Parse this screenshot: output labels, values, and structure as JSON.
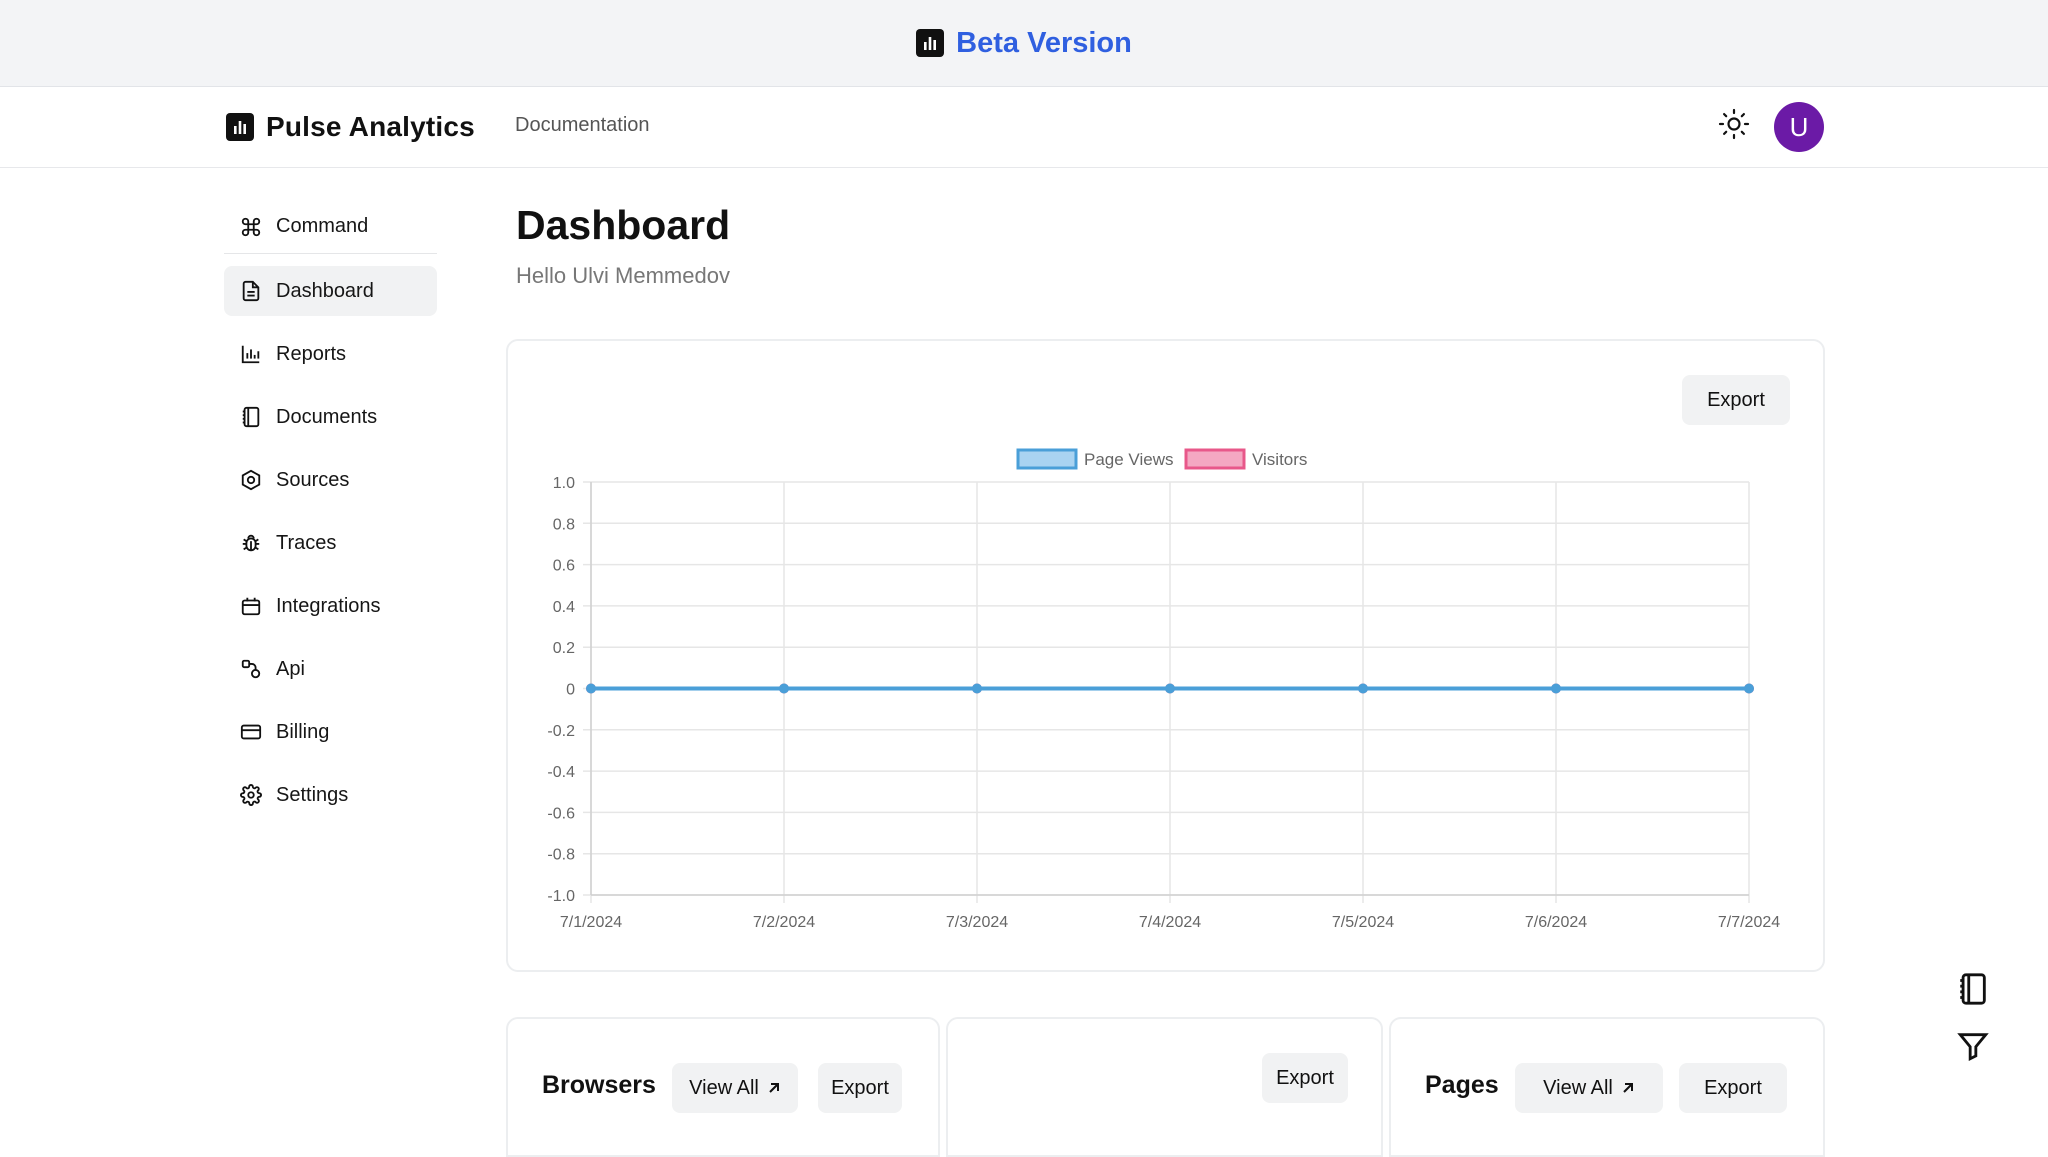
{
  "banner": {
    "text": "Beta Version",
    "icon": "bar-chart-icon"
  },
  "header": {
    "brand": "Pulse Analytics",
    "nav_link": "Documentation",
    "theme_icon": "sun-icon",
    "avatar_initial": "U",
    "avatar_color": "#6b1aa6"
  },
  "sidebar": {
    "items": [
      {
        "label": "Command",
        "icon": "command-icon"
      },
      {
        "label": "Dashboard",
        "icon": "file-text-icon"
      },
      {
        "label": "Reports",
        "icon": "bar-chart-icon"
      },
      {
        "label": "Documents",
        "icon": "notebook-icon"
      },
      {
        "label": "Sources",
        "icon": "hexagon-icon"
      },
      {
        "label": "Traces",
        "icon": "bug-icon"
      },
      {
        "label": "Integrations",
        "icon": "calendar-icon"
      },
      {
        "label": "Api",
        "icon": "api-icon"
      },
      {
        "label": "Billing",
        "icon": "credit-card-icon"
      },
      {
        "label": "Settings",
        "icon": "gear-icon"
      }
    ]
  },
  "main": {
    "title": "Dashboard",
    "greeting": "Hello Ulvi Memmedov",
    "chart_card": {
      "export_label": "Export"
    },
    "browsers_card": {
      "title": "Browsers",
      "view_all_label": "View All",
      "export_label": "Export"
    },
    "middle_card": {
      "export_label": "Export"
    },
    "pages_card": {
      "title": "Pages",
      "view_all_label": "View All",
      "export_label": "Export"
    }
  },
  "chart_data": {
    "type": "line",
    "x": [
      "7/1/2024",
      "7/2/2024",
      "7/3/2024",
      "7/4/2024",
      "7/5/2024",
      "7/6/2024",
      "7/7/2024"
    ],
    "series": [
      {
        "name": "Page Views",
        "values": [
          0,
          0,
          0,
          0,
          0,
          0,
          0
        ],
        "color": "#4a9fd8"
      },
      {
        "name": "Visitors",
        "values": [
          0,
          0,
          0,
          0,
          0,
          0,
          0
        ],
        "color": "#e8588a"
      }
    ],
    "yticks": [
      "1.0",
      "0.8",
      "0.6",
      "0.4",
      "0.2",
      "0",
      "-0.2",
      "-0.4",
      "-0.6",
      "-0.8",
      "-1.0"
    ],
    "ylim": [
      -1,
      1
    ],
    "grid": true,
    "legend": "top-center"
  },
  "floating": {
    "icons": [
      "notebook-icon",
      "filter-icon"
    ]
  }
}
